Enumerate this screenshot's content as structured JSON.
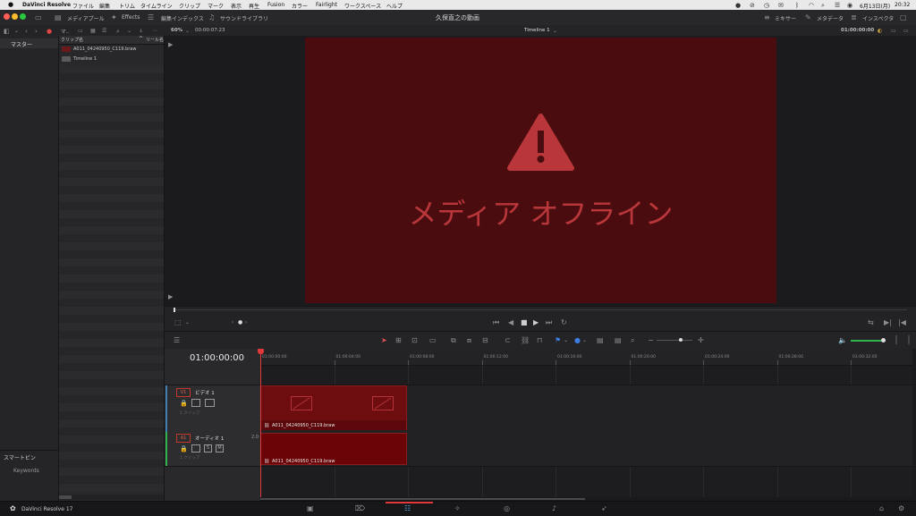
{
  "menubar": {
    "app": "DaVinci Resolve",
    "items": [
      "ファイル",
      "編集",
      "トリム",
      "タイムライン",
      "クリップ",
      "マーク",
      "表示",
      "再生",
      "Fusion",
      "カラー",
      "Fairlight",
      "ワークスペース",
      "ヘルプ"
    ],
    "date": "6月13日(月)",
    "time": "20:32"
  },
  "toolbar": {
    "media_pool": "メディアプール",
    "effects": "Effects",
    "edit_index": "編集インデックス",
    "sound_library": "サウンドライブラリ",
    "project_title": "久保直之の動画",
    "mixer": "ミキサー",
    "metadata": "メタデータ",
    "inspector": "インスペクタ"
  },
  "subbar": {
    "bin_label": "マ..",
    "zoom": "60%",
    "duration": "00:00:07:23",
    "timeline_name": "Timeline 1",
    "timecode": "01:00:00:00"
  },
  "bins": {
    "master": "マスター",
    "smart_bins": "スマートビン",
    "keywords": "Keywords"
  },
  "clip_list": {
    "col_clip_name": "クリップ名",
    "col_reel_name": "リール名",
    "items": [
      "A011_04240950_C119.braw",
      "Timeline 1"
    ]
  },
  "viewer": {
    "offline_text": "メディア オフライン",
    "accent": "#b9373a"
  },
  "timeline": {
    "timecode": "01:00:00:00",
    "ruler": [
      "01:00:00:00",
      "01:00:04:00",
      "01:00:08:00",
      "01:00:12:00",
      "01:00:16:00",
      "01:00:20:00",
      "01:00:24:00",
      "01:00:28:00",
      "01:00:32:00"
    ],
    "video_track": {
      "id": "V1",
      "name": "ビデオ 1",
      "count": "1 クリップ"
    },
    "audio_track": {
      "id": "A1",
      "name": "オーディオ 1",
      "level": "2.0",
      "count": "1 クリップ"
    },
    "video_clip": "A011_04240950_C119.braw",
    "audio_clip": "A011_04240950_C119.braw"
  },
  "bottom": {
    "app_name": "DaVinci Resolve 17"
  }
}
